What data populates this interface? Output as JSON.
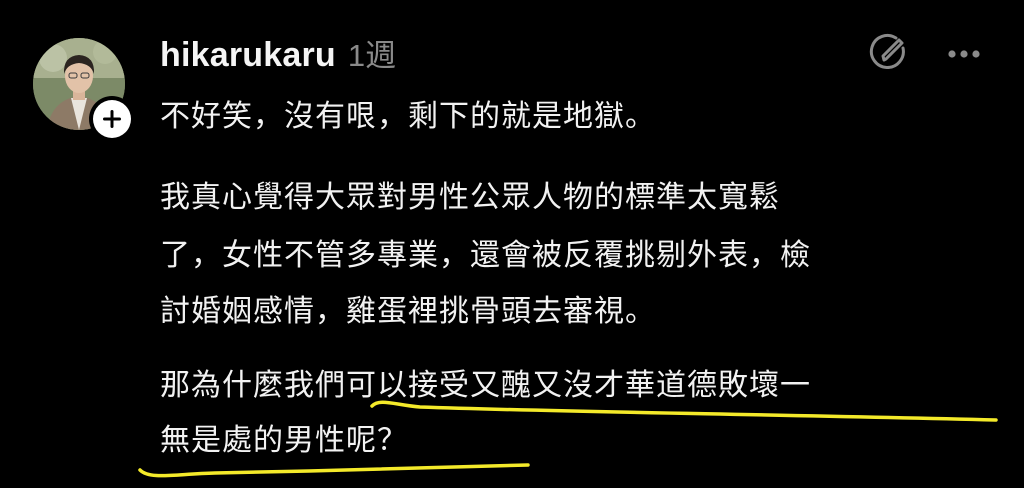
{
  "post": {
    "author": {
      "username": "hikarukaru",
      "avatar_icon": "person-photo-avatar",
      "follow_icon": "plus-icon"
    },
    "timestamp": "1週",
    "actions": {
      "edit_icon": "edit-pencil-icon",
      "more_icon": "more-horizontal-icon"
    },
    "body": {
      "paragraph_1": "不好笑，沒有哏，剩下的就是地獄。",
      "paragraph_2_lines": [
        "我真心覺得大眾對男性公眾人物的標準太寬鬆",
        "了，女性不管多專業，還會被反覆挑剔外表，檢",
        "討婚姻感情，雞蛋裡挑骨頭去審視。"
      ],
      "paragraph_3_lines": [
        "那為什麼我們可以接受又醜又沒才華道德敗壞一",
        "無是處的男性呢？"
      ]
    },
    "colors": {
      "background": "#000000",
      "text": "#f2f2f2",
      "muted": "#8a8a8a",
      "highlight_marker": "#f4ea2a"
    }
  }
}
